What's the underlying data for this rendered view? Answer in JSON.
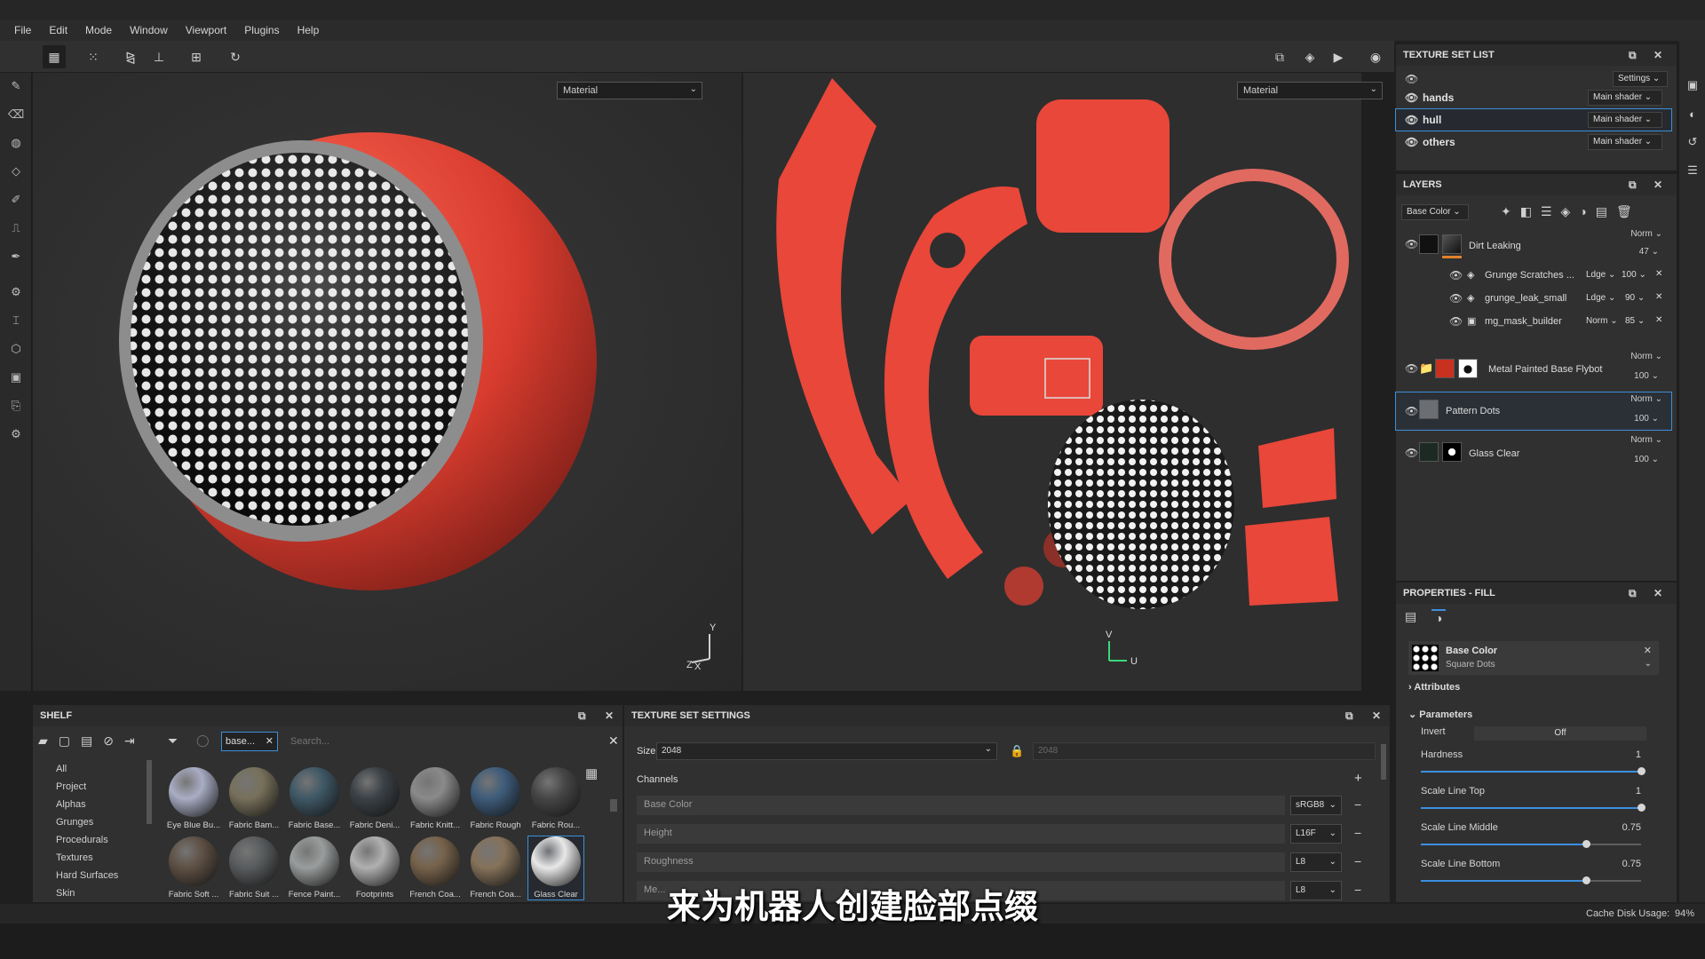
{
  "menu": [
    "File",
    "Edit",
    "Mode",
    "Window",
    "Viewport",
    "Plugins",
    "Help"
  ],
  "viewport": {
    "left_dropdown": "Material",
    "right_dropdown": "Material",
    "axis_3d": {
      "y": "Y",
      "x": "X",
      "z": "Z"
    },
    "axis_uv": {
      "v": "V",
      "u": "U"
    }
  },
  "texture_set_list": {
    "title": "TEXTURE SET LIST",
    "settings_label": "Settings",
    "sets": [
      {
        "name": "hands",
        "shader": "Main shader"
      },
      {
        "name": "hull",
        "shader": "Main shader",
        "selected": true
      },
      {
        "name": "others",
        "shader": "Main shader"
      }
    ]
  },
  "layers": {
    "title": "LAYERS",
    "channel_dropdown": "Base Color",
    "items": [
      {
        "name": "Dirt Leaking",
        "blend": "Norm",
        "opacity": "47"
      },
      {
        "name": "Grunge Scratches ...",
        "blend": "Ldge",
        "opacity": "100"
      },
      {
        "name": "grunge_leak_small",
        "blend": "Ldge",
        "opacity": "90"
      },
      {
        "name": "mg_mask_builder",
        "blend": "Norm",
        "opacity": "85"
      },
      {
        "name": "Metal Painted Base Flybot",
        "blend": "Norm",
        "opacity": "100"
      },
      {
        "name": "Pattern Dots",
        "blend": "Norm",
        "opacity": "100"
      },
      {
        "name": "Glass Clear",
        "blend": "Norm",
        "opacity": "100"
      }
    ]
  },
  "properties": {
    "title": "PROPERTIES - FILL",
    "fill_name": "Base Color",
    "fill_sub": "Square Dots",
    "attributes": "Attributes",
    "parameters": "Parameters",
    "invert_label": "Invert",
    "invert_value": "Off",
    "params": [
      {
        "label": "Hardness",
        "value": "1",
        "fraction": 1.0
      },
      {
        "label": "Scale Line Top",
        "value": "1",
        "fraction": 1.0
      },
      {
        "label": "Scale Line Middle",
        "value": "0.75",
        "fraction": 0.75
      },
      {
        "label": "Scale Line Bottom",
        "value": "0.75",
        "fraction": 0.75
      }
    ]
  },
  "shelf": {
    "title": "SHELF",
    "filter_tag": "base...",
    "search_placeholder": "Search...",
    "categories": [
      "All",
      "Project",
      "Alphas",
      "Grunges",
      "Procedurals",
      "Textures",
      "Hard Surfaces",
      "Skin"
    ],
    "materials_row1": [
      {
        "name": "Eye Blue Bu...",
        "color": "#a9adc4"
      },
      {
        "name": "Fabric Bam...",
        "color": "#77705a"
      },
      {
        "name": "Fabric Base...",
        "color": "#3f5866"
      },
      {
        "name": "Fabric Deni...",
        "color": "#3b4146"
      },
      {
        "name": "Fabric Knitt...",
        "color": "#8a8a8a"
      },
      {
        "name": "Fabric Rough",
        "color": "#3e5c7a"
      },
      {
        "name": "Fabric Rou...",
        "color": "#464646"
      }
    ],
    "materials_row2": [
      {
        "name": "Fabric Soft ...",
        "color": "#5e5044"
      },
      {
        "name": "Fabric Suit ...",
        "color": "#595c5e"
      },
      {
        "name": "Fence Paint...",
        "color": "#9a9d9d"
      },
      {
        "name": "Footprints",
        "color": "#b0b0b0"
      },
      {
        "name": "French Coa...",
        "color": "#76624b"
      },
      {
        "name": "French Coa...",
        "color": "#85725a"
      },
      {
        "name": "Glass Clear",
        "color": "#e8e8e8"
      }
    ]
  },
  "texture_set_settings": {
    "title": "TEXTURE SET SETTINGS",
    "size_label": "Size",
    "size_value": "2048",
    "size_value_locked": "2048",
    "channels_label": "Channels",
    "channels": [
      {
        "name": "Base Color",
        "format": "sRGB8"
      },
      {
        "name": "Height",
        "format": "L16F"
      },
      {
        "name": "Roughness",
        "format": "L8"
      },
      {
        "name": "Me...",
        "format": "L8"
      }
    ]
  },
  "status": {
    "cache_label": "Cache Disk Usage:",
    "cache_value": "94%"
  },
  "subtitle": "来为机器人创建脸部点缀",
  "colors": {
    "accent": "#3c8fe0",
    "paint_red": "#e8473a",
    "panel": "#303030"
  }
}
